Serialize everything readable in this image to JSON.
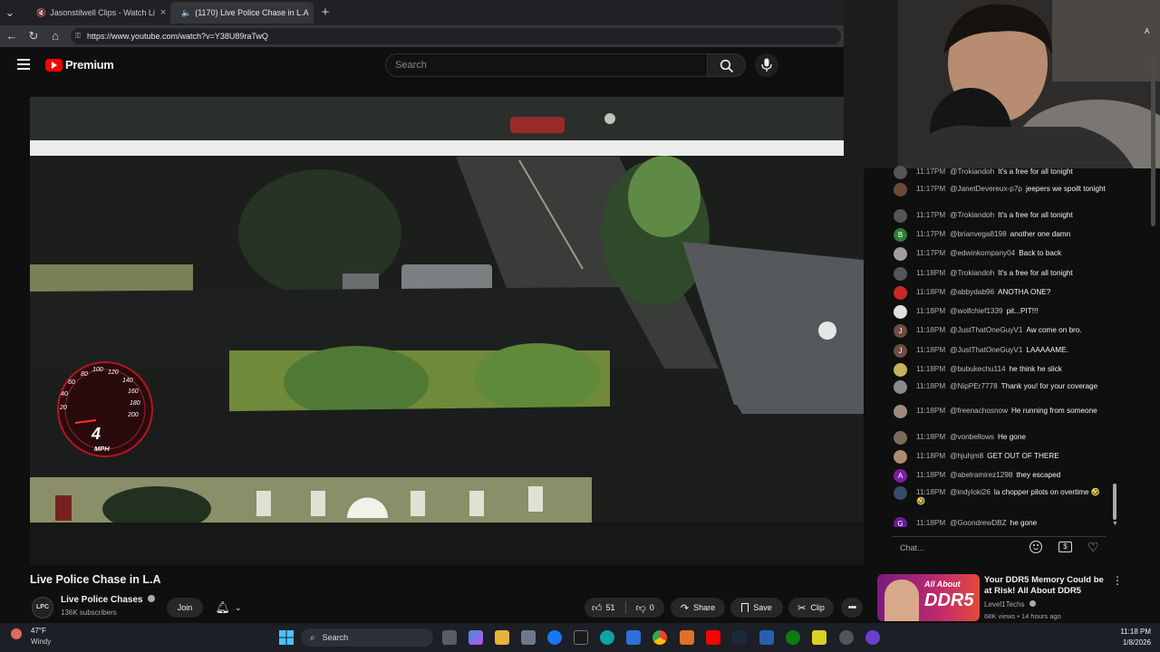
{
  "browser": {
    "tabs": [
      {
        "label": "Jasonstilwell Clips - Watch Li",
        "icon_color": "#53fc18"
      },
      {
        "label": "(1170) Live Police Chase in L.A",
        "icon_color": "#ff0000"
      }
    ],
    "url": "https://www.youtube.com/watch?v=Y38U89raTwQ"
  },
  "youtube": {
    "brand": "Premium",
    "search_placeholder": "Search"
  },
  "video": {
    "speedometer": {
      "ticks": [
        "20",
        "40",
        "60",
        "80",
        "100",
        "120",
        "140",
        "160",
        "180",
        "200"
      ],
      "value": "4",
      "unit": "MPH"
    }
  },
  "chat": {
    "messages": [
      {
        "time": "11:17PM",
        "user": "@Trokiandoh",
        "text": "It's a free for all tonight",
        "avatar": "",
        "avatar_color": "#555555"
      },
      {
        "time": "11:17PM",
        "user": "@JanetDevereux-p7p",
        "text": "jeepers we spoilt tonight",
        "avatar": "",
        "avatar_color": "#6b4a3a"
      },
      {
        "time": "11:17PM",
        "user": "@Trokiandoh",
        "text": "It's a free for all tonight",
        "avatar": "",
        "avatar_color": "#555555"
      },
      {
        "time": "11:17PM",
        "user": "@brianvega8198",
        "text": "another one damn",
        "avatar": "B",
        "avatar_color": "#2e7d32"
      },
      {
        "time": "11:17PM",
        "user": "@edwinkompany04",
        "text": "Back to back",
        "avatar": "",
        "avatar_color": "#9e9e9e"
      },
      {
        "time": "11:18PM",
        "user": "@Trokiandoh",
        "text": "It's a free for all tonight",
        "avatar": "",
        "avatar_color": "#555555"
      },
      {
        "time": "11:18PM",
        "user": "@abbydab96",
        "text": "ANOTHA ONE?",
        "avatar": "",
        "avatar_color": "#c62828"
      },
      {
        "time": "11:18PM",
        "user": "@wolfchief1339",
        "text": "pit...PIT!!!",
        "avatar": "",
        "avatar_color": "#e0e0e0"
      },
      {
        "time": "11:18PM",
        "user": "@JustThatOneGuyV1",
        "text": "Aw come on bro.",
        "avatar": "J",
        "avatar_color": "#6d4c41"
      },
      {
        "time": "11:18PM",
        "user": "@JustThatOneGuyV1",
        "text": "LAAAAAME.",
        "avatar": "J",
        "avatar_color": "#6d4c41"
      },
      {
        "time": "11:18PM",
        "user": "@bubukechu114",
        "text": "he think he slick",
        "avatar": "",
        "avatar_color": "#c6b25a"
      },
      {
        "time": "11:18PM",
        "user": "@NipPEr7778",
        "text": "Thank you! for your coverage",
        "avatar": "",
        "avatar_color": "#8a8a8a"
      },
      {
        "time": "11:18PM",
        "user": "@freenachosnow",
        "text": "He running from someone",
        "avatar": "",
        "avatar_color": "#a1887f"
      },
      {
        "time": "11:18PM",
        "user": "@vonbellows",
        "text": "He gone",
        "avatar": "",
        "avatar_color": "#7a6a5a"
      },
      {
        "time": "11:18PM",
        "user": "@hjuhjm8",
        "text": "GET OUT OF THERE",
        "avatar": "",
        "avatar_color": "#b08a70"
      },
      {
        "time": "11:18PM",
        "user": "@abelramirez1298",
        "text": "they escaped",
        "avatar": "A",
        "avatar_color": "#7b1fa2"
      },
      {
        "time": "11:18PM",
        "user": "@indyloki26",
        "text": "la chopper pilots on overtime 🤣 🤣",
        "avatar": "",
        "avatar_color": "#3a4a6a"
      },
      {
        "time": "11:18PM",
        "user": "@GoondrewDBZ",
        "text": "he gone",
        "avatar": "G",
        "avatar_color": "#6a1b9a"
      }
    ],
    "input_placeholder": "Chat..."
  },
  "below_video": {
    "title": "Live Police Chase in L.A",
    "channel": "Live Police Chases",
    "subscribers": "136K subscribers",
    "join_label": "Join",
    "likes": "51",
    "dislikes": "0",
    "share_label": "Share",
    "save_label": "Save",
    "clip_label": "Clip"
  },
  "recommendation": {
    "title": "Your DDR5 Memory Could be at Risk! All About DDR5",
    "channel": "Level1Techs",
    "meta": "68K views • 14 hours ago",
    "thumb_text_1": "All About",
    "thumb_text_2": "DDR5"
  },
  "taskbar": {
    "weather_temp": "47°F",
    "weather_desc": "Windy",
    "search_label": "Search",
    "time": "11:18 PM",
    "date": "1/8/2026"
  }
}
